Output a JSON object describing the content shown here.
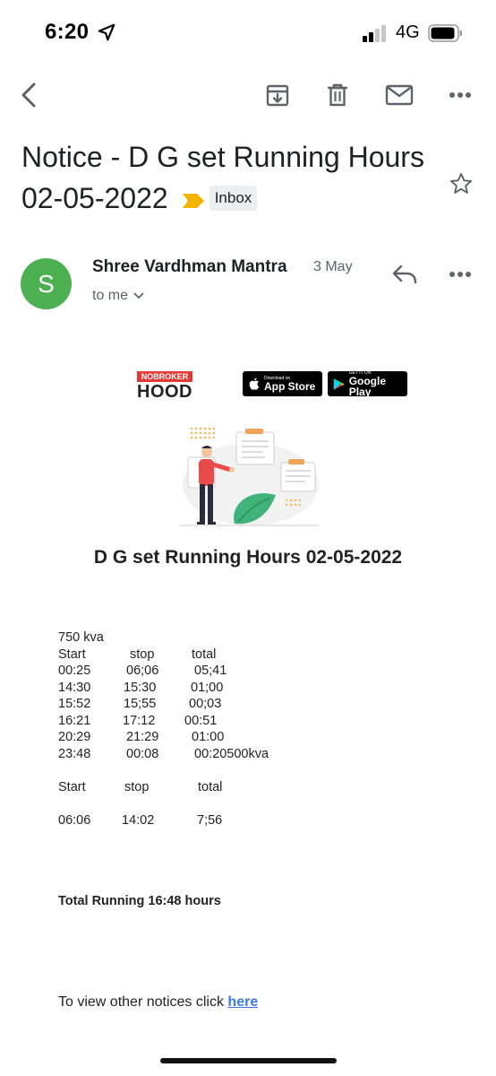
{
  "status_bar": {
    "time": "6:20",
    "network": "4G"
  },
  "toolbar": {
    "back_icon": "back-arrow-icon",
    "archive_icon": "archive-icon",
    "delete_icon": "trash-icon",
    "mark_unread_icon": "mail-icon",
    "more_icon": "more-horizontal-icon"
  },
  "subject": {
    "title": "Notice - D G set Running Hours 02-05-2022",
    "label": "Inbox",
    "label_color": "#f4b400"
  },
  "sender": {
    "avatar_letter": "S",
    "avatar_color": "#4caf50",
    "name": "Shree Vardhman Mantra",
    "date": "3 May",
    "recipient": "to me"
  },
  "email": {
    "brand": {
      "top": "NOBROKER",
      "bottom": "HOOD"
    },
    "app_store": {
      "small": "Download on",
      "big": "App Store"
    },
    "google_play": {
      "small": "GET IT ON",
      "big": "Google Play"
    },
    "heading": "D G set Running Hours 02-05-2022",
    "capacity": "750 kva",
    "table1": {
      "headers": [
        "Start",
        "stop",
        "total"
      ],
      "rows": [
        [
          "00:25",
          "06;06",
          "05;41"
        ],
        [
          "14:30",
          "15:30",
          "01;00"
        ],
        [
          "15:52",
          "15;55",
          "00;03"
        ],
        [
          "16:21",
          "17:12",
          "00:51"
        ],
        [
          "20:29",
          "21:29",
          "01:00"
        ],
        [
          "23:48",
          "00:08",
          "00:20500kva"
        ]
      ]
    },
    "table2": {
      "headers": [
        "Start",
        "stop",
        "total"
      ],
      "rows": [
        [
          "06:06",
          "14:02",
          "7;56"
        ]
      ]
    },
    "total_running": "Total Running 16:48 hours",
    "footer_text": "To view other notices click",
    "footer_link": "here"
  }
}
